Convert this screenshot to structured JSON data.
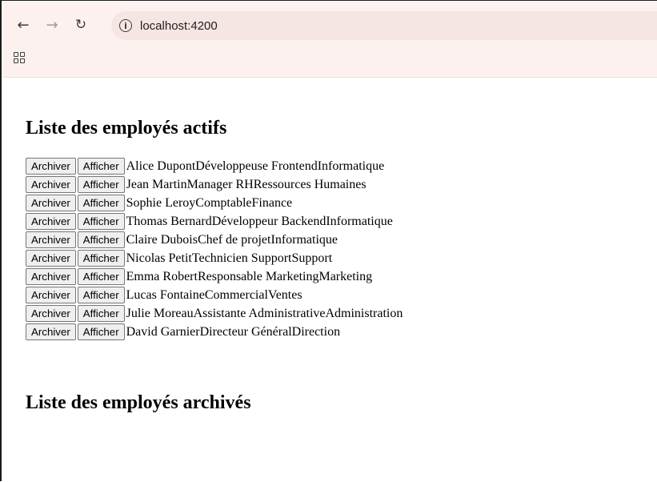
{
  "browser": {
    "url": "localhost:4200"
  },
  "page": {
    "active_title": "Liste des employés actifs",
    "archived_title": "Liste des employés archivés",
    "archive_label": "Archiver",
    "show_label": "Afficher"
  },
  "employees": [
    {
      "name": "Alice Dupont",
      "role": "Développeuse Frontend",
      "dept": "Informatique"
    },
    {
      "name": "Jean Martin",
      "role": "Manager RH",
      "dept": "Ressources Humaines"
    },
    {
      "name": "Sophie Leroy",
      "role": "Comptable",
      "dept": "Finance"
    },
    {
      "name": "Thomas Bernard",
      "role": "Développeur Backend",
      "dept": "Informatique"
    },
    {
      "name": "Claire Dubois",
      "role": "Chef de projet",
      "dept": "Informatique"
    },
    {
      "name": "Nicolas Petit",
      "role": "Technicien Support",
      "dept": "Support"
    },
    {
      "name": "Emma Robert",
      "role": "Responsable Marketing",
      "dept": "Marketing"
    },
    {
      "name": "Lucas Fontaine",
      "role": "Commercial",
      "dept": "Ventes"
    },
    {
      "name": "Julie Moreau",
      "role": "Assistante Administrative",
      "dept": "Administration"
    },
    {
      "name": "David Garnier",
      "role": "Directeur Général",
      "dept": "Direction"
    }
  ]
}
